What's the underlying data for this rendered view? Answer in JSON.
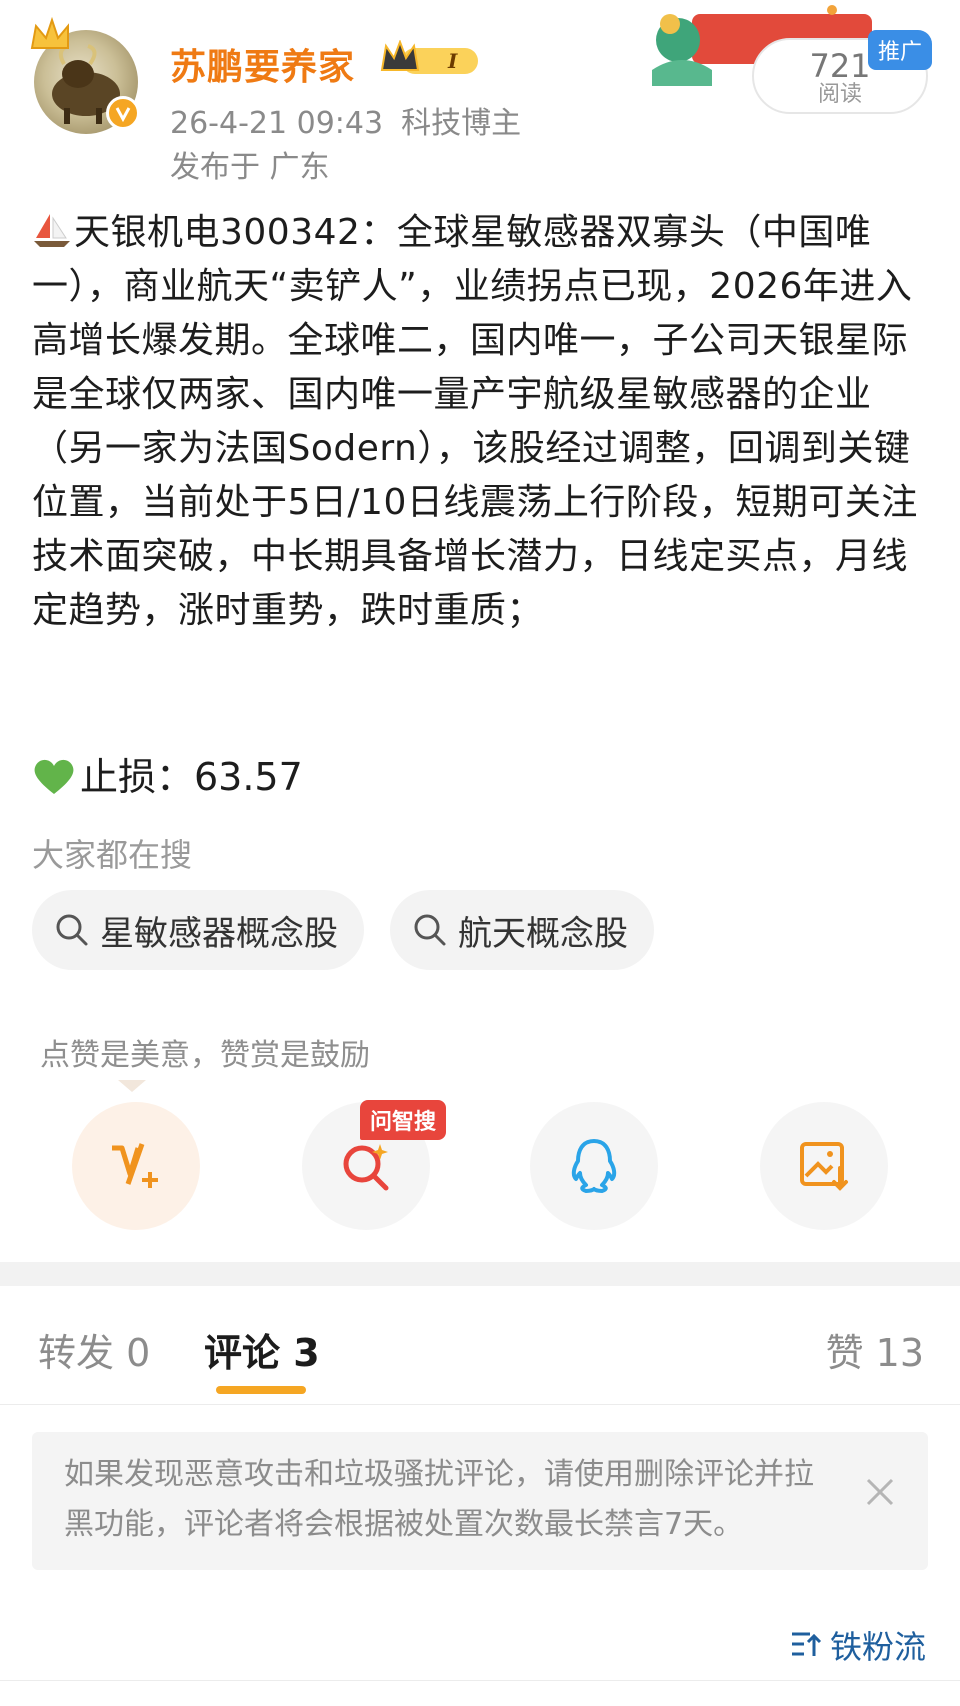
{
  "header": {
    "username": "苏鹏要养家",
    "vip_level": "I",
    "timestamp": "26-4-21 09:43",
    "tag": "科技博主",
    "location": "发布于 广东",
    "read_count": "721",
    "read_label": "阅读",
    "promo_tag": "推广"
  },
  "post": {
    "body": "天银机电300342：全球星敏感器双寡头（中国唯一），商业航天“卖铲人”，业绩拐点已现，2026年进入高增长爆发期。全球唯二，国内唯一，子公司天银星际是全球仅两家、国内唯一量产宇航级星敏感器的企业（另一家为法国Sodern），该股经过调整，回调到关键位置，当前处于5日/10日线震荡上行阶段，短期可关注技术面突破，中长期具备增长潜力，日线定买点，月线定趋势，涨时重势，跌时重质；",
    "stoploss": "止损：63.57"
  },
  "search": {
    "title": "大家都在搜",
    "chips": [
      "星敏感器概念股",
      "航天概念股"
    ]
  },
  "actions": {
    "encourage": "点赞是美意，赞赏是鼓励",
    "wenzhisou_tag": "问智搜"
  },
  "tabs": {
    "repost": "转发 0",
    "comment": "评论 3",
    "like": "赞 13"
  },
  "notice": {
    "text": "如果发现恶意攻击和垃圾骚扰评论，请使用删除评论并拉黑功能，评论者将会根据被处置次数最长禁言7天。"
  },
  "sort": {
    "label": "铁粉流"
  },
  "colors": {
    "username": "#ef7a13",
    "accent": "#f5a623",
    "link": "#1f5f9e",
    "wz_tag": "#e8453c"
  }
}
